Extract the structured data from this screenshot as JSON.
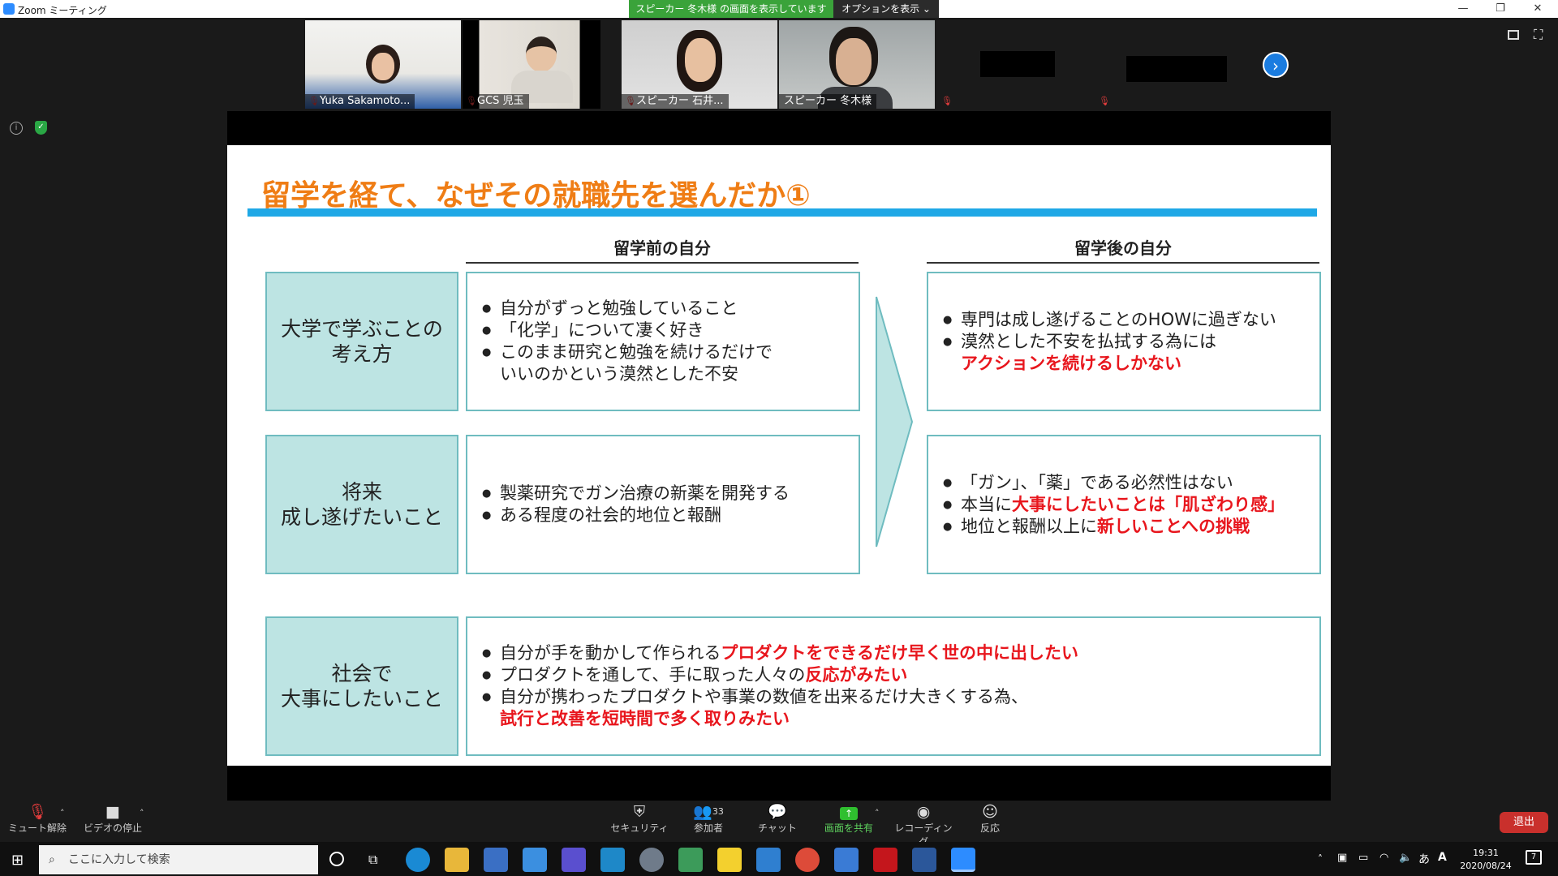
{
  "window": {
    "title": "Zoom ミーティング",
    "share_banner": "スピーカー 冬木様 の画面を表示しています",
    "options_label": "オプションを表示 ⌄",
    "minimize": "—",
    "restore": "❐",
    "close": "✕"
  },
  "participants": [
    {
      "name": "Yuka Sakamoto..."
    },
    {
      "name": "GCS 児玉"
    },
    {
      "name": "スピーカー 石井..."
    },
    {
      "name": "スピーカー 冬木様"
    },
    {
      "name": ""
    },
    {
      "name": ""
    }
  ],
  "slide": {
    "title": "留学を経て、なぜその就職先を選んだか①",
    "col_before": "留学前の自分",
    "col_after": "留学後の自分",
    "rows": [
      {
        "label_lines": [
          "大学で学ぶことの",
          "考え方"
        ],
        "before": [
          "自分がずっと勉強していること",
          "「化学」について凄く好き",
          "このまま研究と勉強を続けるだけで"
        ],
        "before_cont": "いいのかという漠然とした不安",
        "after_1": "専門は成し遂げることのHOWに過ぎない",
        "after_2": "漠然とした不安を払拭する為には",
        "after_2_red": "アクションを続けるしかない"
      },
      {
        "label_lines": [
          "将来",
          "成し遂げたいこと"
        ],
        "before": [
          "製薬研究でガン治療の新薬を開発する",
          "ある程度の社会的地位と報酬"
        ],
        "after_1": "「ガン」、「薬」である必然性はない",
        "after_2_pre": "本当に",
        "after_2_red": "大事にしたいことは「肌ざわり感」",
        "after_3_pre": "地位と報酬以上に",
        "after_3_red": "新しいことへの挑戦"
      },
      {
        "label_lines": [
          "社会で",
          "大事にしたいこと"
        ],
        "b1_pre": "自分が手を動かして作られる",
        "b1_red": "プロダクトをできるだけ早く世の中に出したい",
        "b2_pre": "プロダクトを通して、手に取った人々の",
        "b2_red": "反応がみたい",
        "b3_pre": "自分が携わったプロダクトや事業の数値を出来るだけ大きくする為、",
        "b3_red": "試行と改善を短時間で多く取りみたい"
      }
    ]
  },
  "toolbar": {
    "mute": "ミュート解除",
    "video": "ビデオの停止",
    "security": "セキュリティ",
    "participants": "参加者",
    "participants_count": "33",
    "chat": "チャット",
    "share": "画面を共有",
    "record": "レコーディング",
    "reactions": "反応",
    "leave": "退出"
  },
  "taskbar": {
    "search_placeholder": "ここに入力して検索",
    "time": "19:31",
    "date": "2020/08/24",
    "ime": "あ",
    "notifications": "7"
  }
}
